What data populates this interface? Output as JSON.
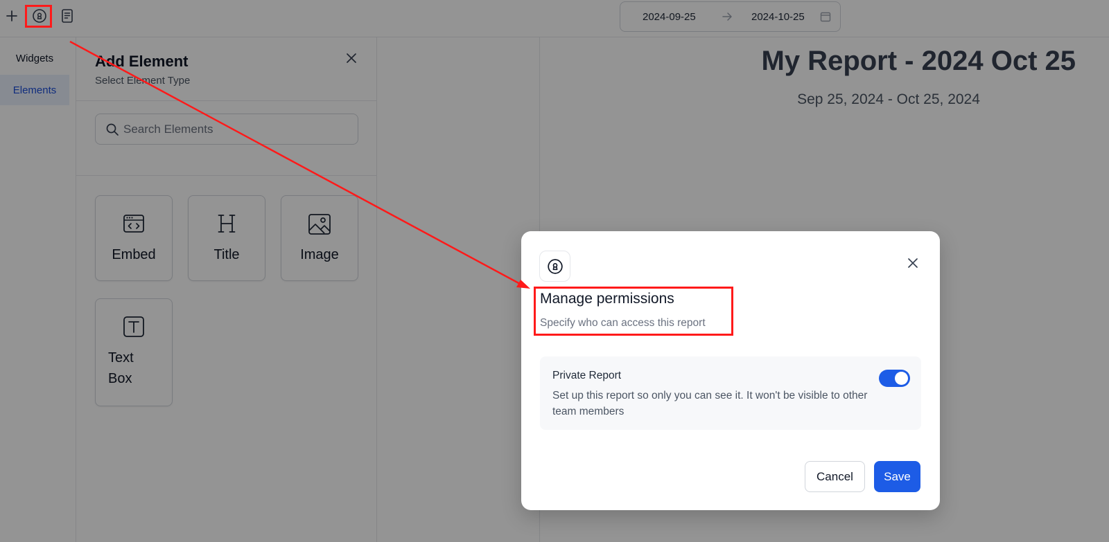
{
  "topbar": {
    "date_start": "2024-09-25",
    "date_end": "2024-10-25",
    "icons": [
      "plus-icon",
      "lock-icon",
      "document-icon",
      "arrow-right-icon",
      "calendar-icon"
    ]
  },
  "leftnav": {
    "items": [
      {
        "label": "Widgets",
        "active": false
      },
      {
        "label": "Elements",
        "active": true
      }
    ]
  },
  "panel": {
    "title": "Add Element",
    "subtitle": "Select Element Type",
    "search_placeholder": "Search Elements",
    "search_value": "",
    "elements": [
      {
        "label": "Embed",
        "icon": "embed-icon"
      },
      {
        "label": "Title",
        "icon": "heading-icon"
      },
      {
        "label": "Image",
        "icon": "image-icon"
      },
      {
        "label": "Text Box",
        "icon": "text-box-icon"
      }
    ]
  },
  "report": {
    "title": "My Report - 2024 Oct 25",
    "date_range": "Sep 25, 2024 - Oct 25, 2024"
  },
  "modal": {
    "title": "Manage permissions",
    "subtitle": "Specify who can access this report",
    "setting_title": "Private Report",
    "setting_description": "Set up this report so only you can see it. It won't be visible to other team members",
    "private_enabled": true,
    "cancel_label": "Cancel",
    "save_label": "Save"
  },
  "colors": {
    "accent": "#1d5ce6",
    "annotation": "#ff1a1a",
    "nav_active_bg": "#e8effc"
  }
}
